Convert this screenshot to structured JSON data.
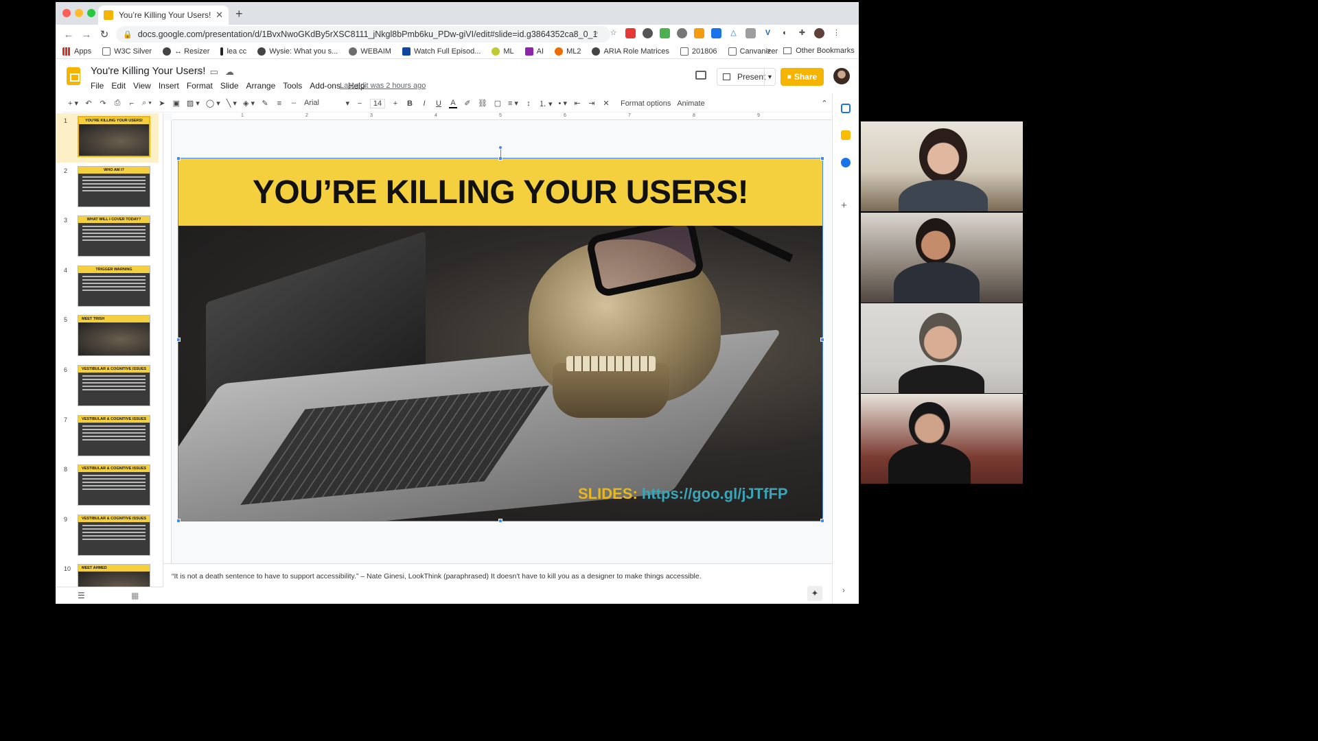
{
  "browser": {
    "tab_title": "You’re Killing Your Users! - Go",
    "url": "docs.google.com/presentation/d/1BvxNwoGKdBy5rXSC8111_jNkgl8bPmb6ku_PDw-giVI/edit#slide=id.g3864352ca8_0_1",
    "bookmarks": [
      "Apps",
      "W3C Silver",
      "↔ Resizer",
      "lea cc",
      "Wysie: What you s...",
      "WEBAIM",
      "Watch Full Episod...",
      "ML",
      "AI",
      "ML2",
      "ARIA Role Matrices",
      "201806",
      "Canvanizer"
    ],
    "bookmarks_overflow": "»",
    "other_bookmarks": "Other Bookmarks"
  },
  "app": {
    "doc_title": "You're Killing Your Users!",
    "menus": [
      "File",
      "Edit",
      "View",
      "Insert",
      "Format",
      "Slide",
      "Arrange",
      "Tools",
      "Add-ons",
      "Help"
    ],
    "last_edit": "Last edit was 2 hours ago",
    "present_label": "Present",
    "share_label": "Share"
  },
  "toolbar": {
    "font": "Arial",
    "font_size": "14",
    "format_options": "Format options",
    "animate": "Animate"
  },
  "filmstrip": [
    {
      "num": "1",
      "title": "YOU'RE KILLING YOUR USERS!"
    },
    {
      "num": "2",
      "title": "WHO AM I?"
    },
    {
      "num": "3",
      "title": "WHAT WILL I COVER TODAY?"
    },
    {
      "num": "4",
      "title": "TRIGGER WARNING"
    },
    {
      "num": "5",
      "title": "MEET TRISH"
    },
    {
      "num": "6",
      "title": "VESTIBULAR & COGNITIVE ISSUES"
    },
    {
      "num": "7",
      "title": "VESTIBULAR & COGNITIVE ISSUES"
    },
    {
      "num": "8",
      "title": "VESTIBULAR & COGNITIVE ISSUES"
    },
    {
      "num": "9",
      "title": "VESTIBULAR & COGNITIVE ISSUES"
    },
    {
      "num": "10",
      "title": "MEET AHMED"
    }
  ],
  "ruler": [
    "1",
    "2",
    "3",
    "4",
    "5",
    "6",
    "7",
    "8",
    "9"
  ],
  "slide": {
    "heading": "YOU’RE KILLING YOUR USERS!",
    "slides_label": "SLIDES:",
    "slides_url": "https://goo.gl/jJTfFP"
  },
  "notes": "“It is not a death sentence to have to support accessibility.” – Nate Ginesi, LookThink (paraphrased) It doesn't have to kill you as a designer to make things accessible.",
  "colors": {
    "accent_yellow": "#f4b400",
    "slide_band": "#f4d03f",
    "link_teal": "#38a6b8",
    "slides_label": "#e6b824"
  }
}
